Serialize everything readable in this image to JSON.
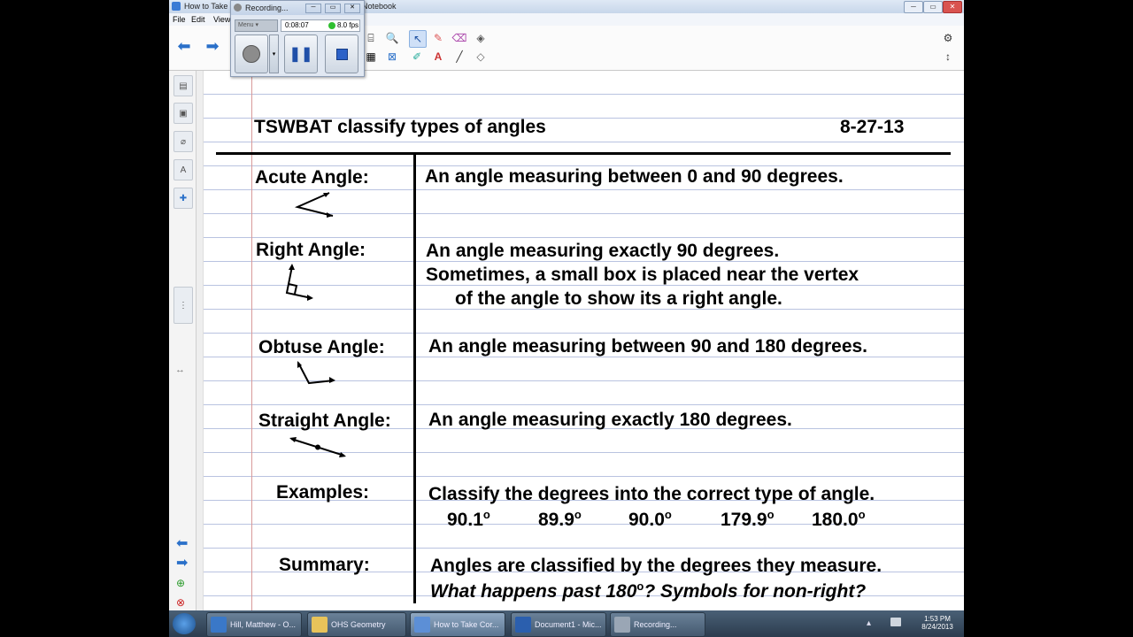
{
  "window": {
    "title_left": "How to Take C",
    "title_right": "Notebook",
    "controls": [
      "─",
      "▭",
      "✕"
    ]
  },
  "menu": [
    "File",
    "Edit",
    "View"
  ],
  "recorder": {
    "title": "Recording...",
    "menu_label": "Menu",
    "elapsed": "0:08:07",
    "fps": "8.0 fps"
  },
  "notes": {
    "header_title": "TSWBAT classify types of angles",
    "header_date": "8-27-13",
    "rows": [
      {
        "term": "Acute Angle:",
        "lines": [
          "An angle measuring between 0 and 90 degrees."
        ]
      },
      {
        "term": "Right Angle:",
        "lines": [
          "An angle measuring exactly 90 degrees.",
          "Sometimes, a small box is placed near the vertex",
          "of the angle to show its a right angle."
        ]
      },
      {
        "term": "Obtuse Angle:",
        "lines": [
          "An angle measuring between 90 and 180 degrees."
        ]
      },
      {
        "term": "Straight Angle:",
        "lines": [
          "An angle measuring exactly 180 degrees."
        ]
      },
      {
        "term": "Examples:",
        "lines": [
          "Classify the degrees into the correct type of angle."
        ]
      },
      {
        "term": "Summary:",
        "lines": [
          "Angles are classified by the degrees they measure.",
          "What happens past 180",
          "?   Symbols for non-right?"
        ]
      }
    ],
    "examples": [
      "90.1",
      "89.9",
      "90.0",
      "179.9",
      "180.0"
    ],
    "degree_symbol": "o"
  },
  "taskbar": {
    "items": [
      "Hill, Matthew - O...",
      "OHS Geometry",
      "How to Take Cor...",
      "Document1 - Mic...",
      "Recording..."
    ],
    "time": "1:53 PM",
    "date": "8/24/2013"
  }
}
